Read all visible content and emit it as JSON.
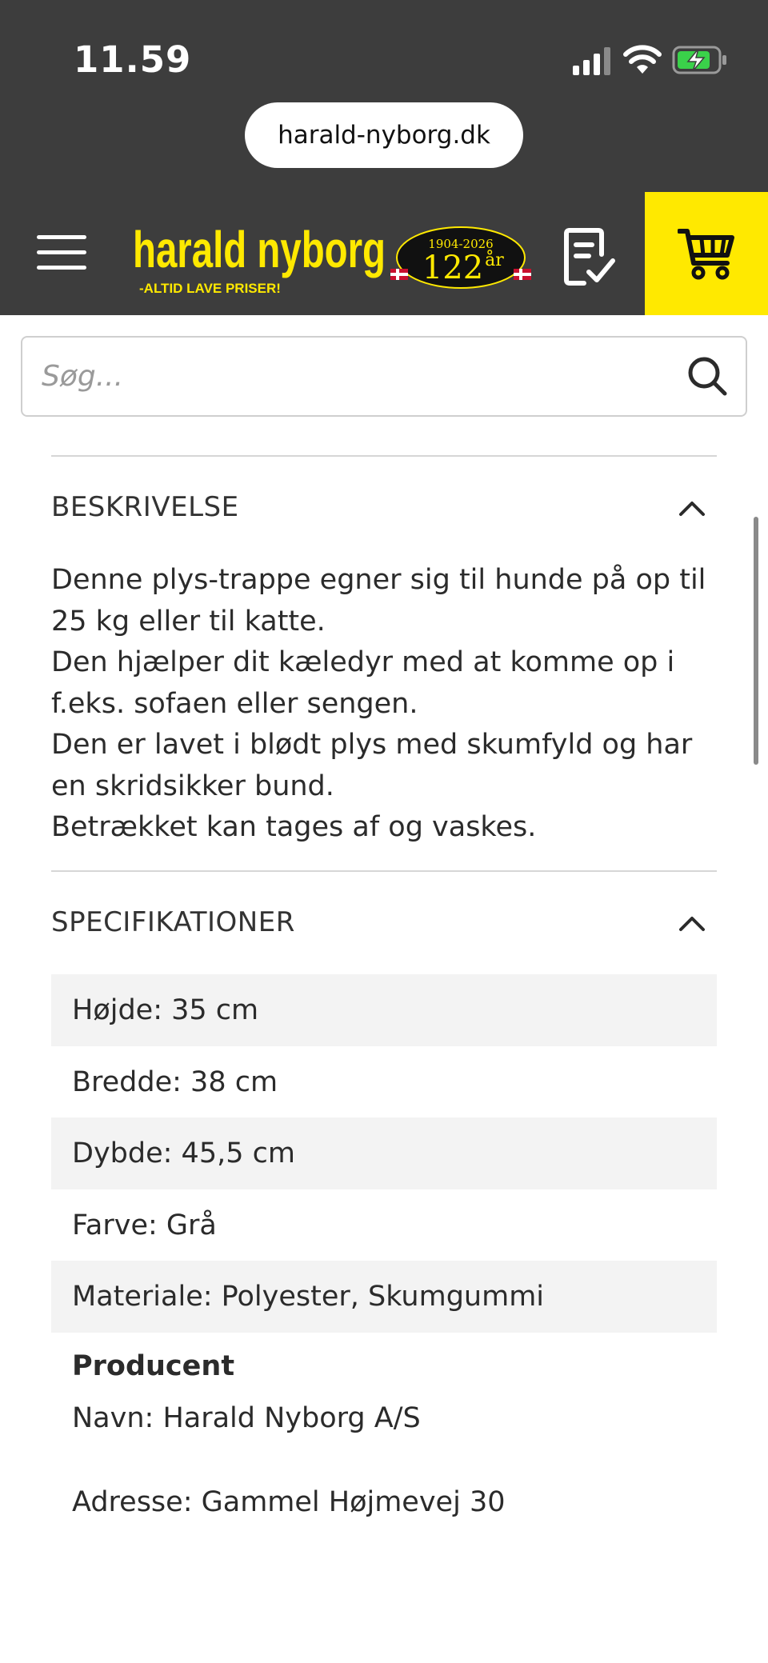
{
  "status_bar": {
    "time": "11.59"
  },
  "browser": {
    "url": "harald-nyborg.dk"
  },
  "header": {
    "logo": {
      "brand": "harald nyborg",
      "slogan": "-ALTID LAVE PRISER!",
      "badge_years": "1904-2026",
      "badge_age": "122",
      "badge_suffix": "år"
    },
    "colors": {
      "header_bg": "#3d3d3d",
      "accent_yellow": "#ffe900"
    }
  },
  "search": {
    "placeholder": "Søg..."
  },
  "description": {
    "title": "BESKRIVELSE",
    "lines": [
      "Denne plys-trappe egner sig til hunde på op til 25 kg eller til katte.",
      "Den hjælper dit kæledyr med at komme op i f.eks. sofaen eller sengen.",
      "Den er lavet i blødt plys med skumfyld og har en skridsikker bund.",
      "Betrækket kan tages af og vaskes."
    ]
  },
  "specifications": {
    "title": "SPECIFIKATIONER",
    "rows": [
      "Højde: 35 cm",
      "Bredde: 38 cm",
      "Dybde: 45,5 cm",
      "Farve: Grå",
      "Materiale: Polyester, Skumgummi"
    ]
  },
  "producer": {
    "title": "Producent",
    "name": "Navn: Harald Nyborg A/S",
    "address": "Adresse: Gammel Højmevej 30"
  }
}
